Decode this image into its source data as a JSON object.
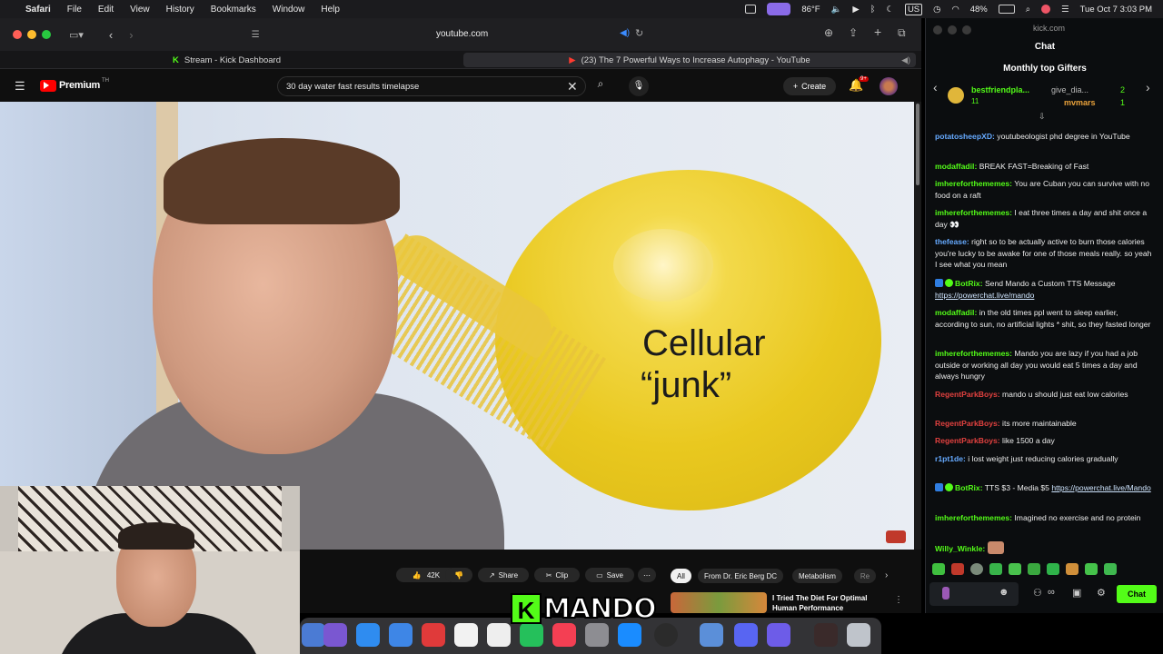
{
  "menubar": {
    "items": [
      "Safari",
      "File",
      "Edit",
      "View",
      "History",
      "Bookmarks",
      "Window",
      "Help"
    ],
    "weather": "86°F",
    "input_source": "US",
    "battery": "48%",
    "datetime": "Tue Oct 7  3:03 PM"
  },
  "safari": {
    "url": "youtube.com",
    "tabs": [
      {
        "label": "Stream - Kick Dashboard"
      },
      {
        "label": "(23) The 7 Powerful Ways to Increase Autophagy - YouTube"
      }
    ],
    "kick_url": "kick.com"
  },
  "youtube": {
    "logo": "Premium",
    "logo_sup": "TH",
    "search_value": "30 day water fast results timelapse",
    "create_label": "Create",
    "notif_count": "9+",
    "video_text_line1": "Cellular",
    "video_text_line2": "“junk”",
    "likes": "42K",
    "share": "Share",
    "clip": "Clip",
    "save": "Save",
    "chips": [
      "All",
      "From Dr. Eric Berg DC",
      "Metabolism",
      "Re"
    ],
    "rec_title_1": "I Tried The Diet For Optimal",
    "rec_title_2": "Human Performance"
  },
  "overlay": {
    "mando": "MANDO"
  },
  "kick": {
    "chat_title": "Chat",
    "gifters_title": "Monthly top Gifters",
    "gifters": [
      {
        "name": "bestfriendpla...",
        "count": "11"
      },
      {
        "name": "give_dia...",
        "count": "2"
      },
      {
        "name": "mvmars",
        "count": "1"
      }
    ],
    "messages": [
      {
        "user": "potatosheepXD:",
        "text": " youtubeologist phd degree in YouTube"
      },
      {
        "user": "modaffadil:",
        "text": " BREAK FAST=Breaking of Fast"
      },
      {
        "user": "imhereforthememes:",
        "text": " You are Cuban you can survive with no food on a raft"
      },
      {
        "user": "imhereforthememes:",
        "text": " I eat three times a day and shit once a day 👀"
      },
      {
        "user": "thefease:",
        "text": " right so to be actually active to burn those calories you're lucky to be awake for one of those meals really. so yeah I see what you mean"
      },
      {
        "user": "BotRix:",
        "text": " Send Mando a Custom TTS Message ",
        "link": "https://powerchat.live/mando"
      },
      {
        "user": "modaffadil:",
        "text": " in the old times ppl went to sleep earlier, according to sun, no artificial lights * shit, so they fasted longer"
      },
      {
        "user": "imhereforthememes:",
        "text": " Mando you are lazy if you had a job outside or working all day you would eat 5 times a day and always hungry"
      },
      {
        "user": "RegentParkBoys:",
        "text": " mando u should just eat low calories"
      },
      {
        "user": "RegentParkBoys:",
        "text": " its more maintainable"
      },
      {
        "user": "RegentParkBoys:",
        "text": " like 1500 a day"
      },
      {
        "user": "r1pt1de:",
        "text": " i lost weight just reducing calories gradually"
      },
      {
        "user": "BotRix:",
        "text": " TTS $3 - Media $5 ",
        "link": "https://powerchat.live/Mando"
      },
      {
        "user": "imhereforthememes:",
        "text": " Imagined no exercise and no protein"
      },
      {
        "user": "Willy_Winkle:",
        "text": ""
      }
    ],
    "send_label": "Chat"
  }
}
